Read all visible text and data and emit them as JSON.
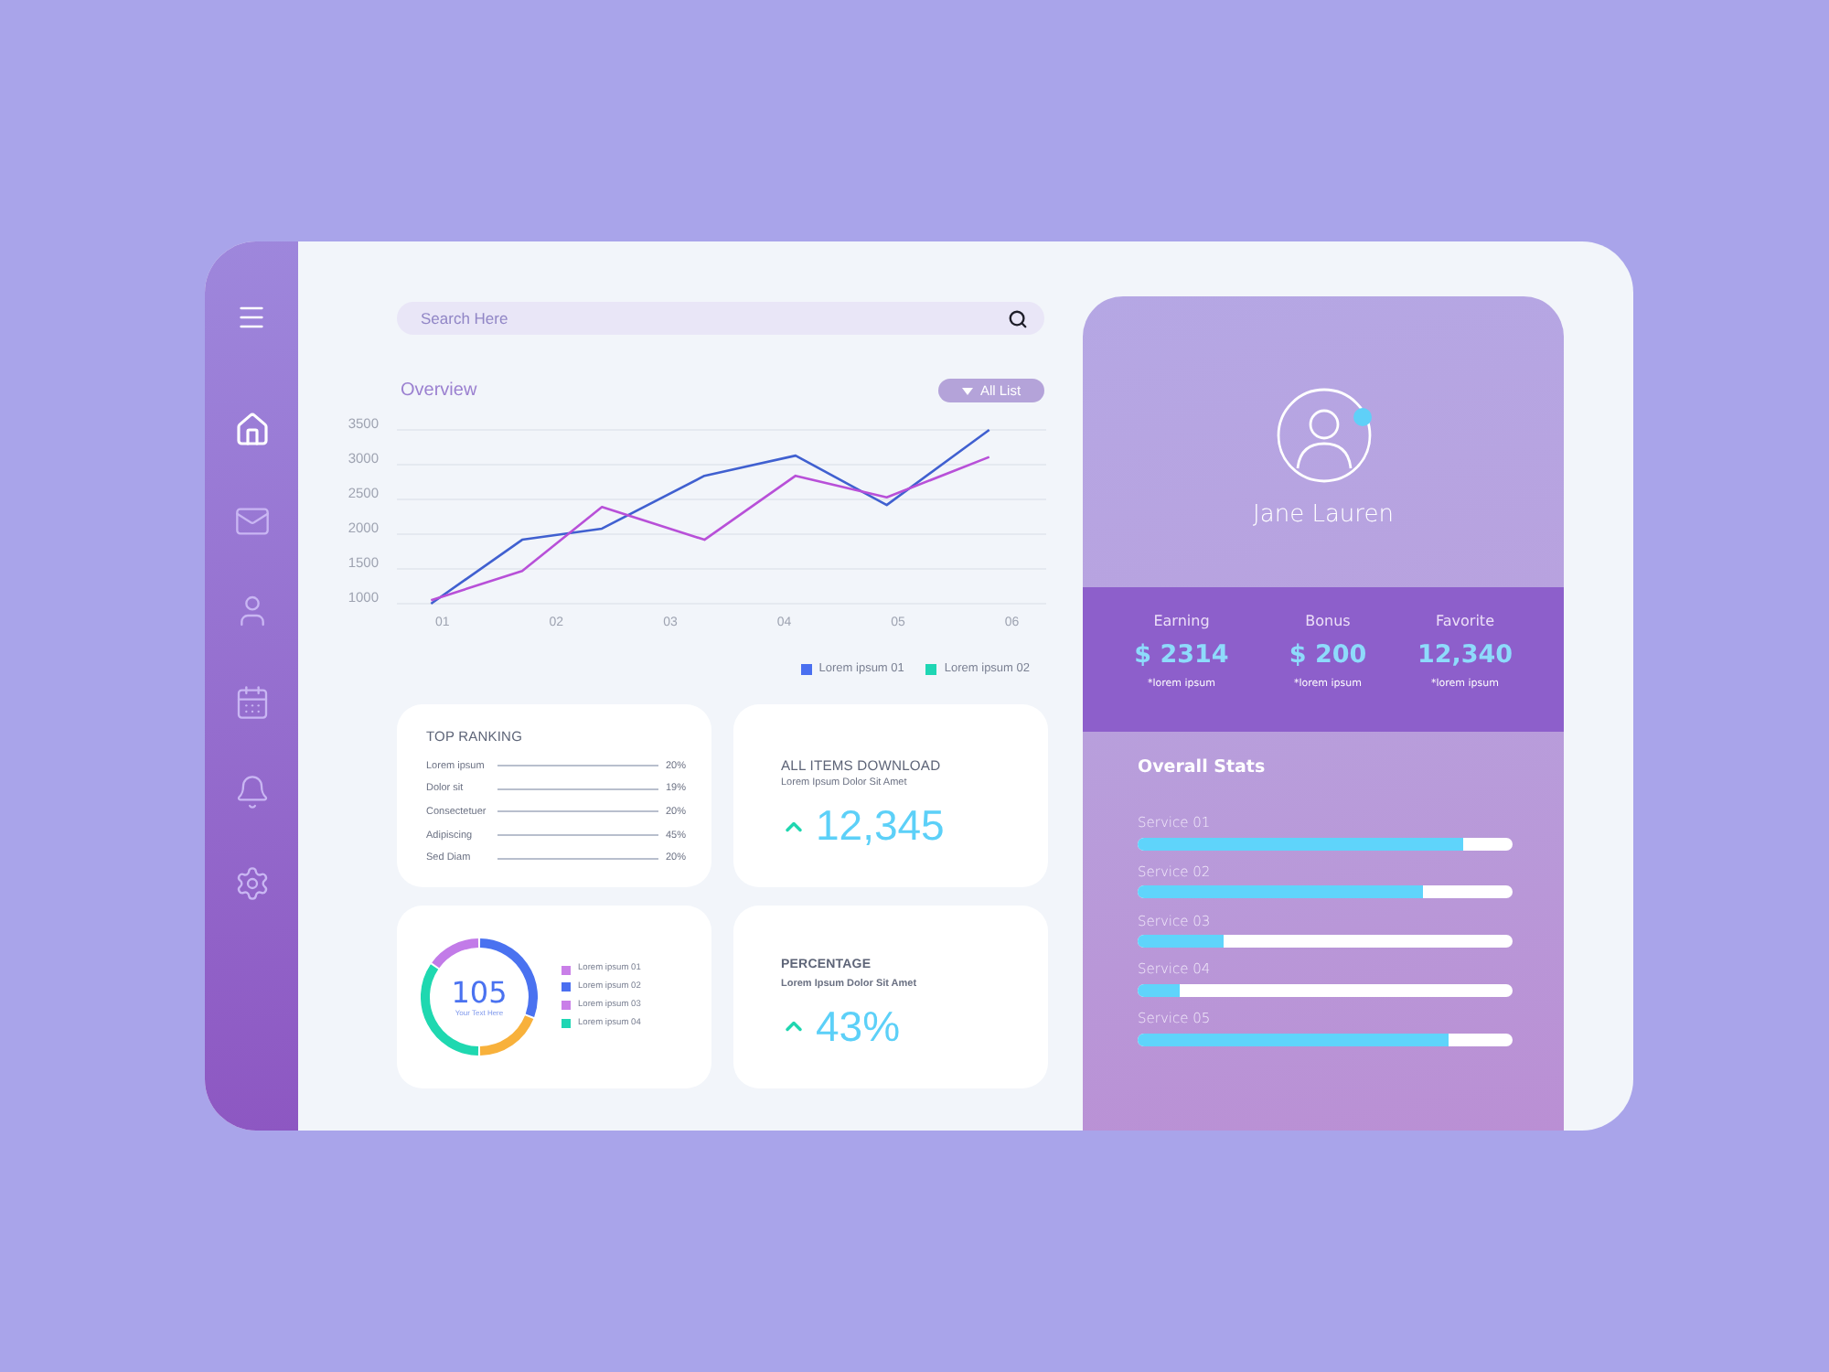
{
  "sidebar": {
    "items": [
      {
        "kind": "home",
        "selected": true
      },
      {
        "kind": "mail",
        "selected": false
      },
      {
        "kind": "user",
        "selected": false
      },
      {
        "kind": "calendar",
        "selected": false
      },
      {
        "kind": "bell",
        "selected": false
      },
      {
        "kind": "settings",
        "selected": false
      }
    ]
  },
  "search": {
    "placeholder": "Search Here"
  },
  "overview": {
    "title": "Overview",
    "filter": {
      "label": "All List"
    },
    "chart_data": {
      "type": "line",
      "grid": true,
      "x": [
        0.9,
        1.7,
        2.4,
        3.3,
        4.1,
        4.9,
        5.8
      ],
      "xlim": [
        0.6,
        6.3
      ],
      "ylim": [
        1000,
        3500
      ],
      "xticks": [
        {
          "value": 1,
          "label": "01"
        },
        {
          "value": 2,
          "label": "02"
        },
        {
          "value": 3,
          "label": "03"
        },
        {
          "value": 4,
          "label": "04"
        },
        {
          "value": 5,
          "label": "05"
        },
        {
          "value": 6,
          "label": "06"
        }
      ],
      "yticks": [
        1000,
        1500,
        2000,
        2500,
        3000,
        3500
      ],
      "series": [
        {
          "name": "Lorem ipsum 01",
          "color": "#4060d0",
          "values": [
            1000,
            1920,
            2080,
            2840,
            3130,
            2420,
            3500
          ]
        },
        {
          "name": "Lorem ipsum 02",
          "color": "#b850d8",
          "values": [
            1050,
            1470,
            2390,
            1920,
            2840,
            2530,
            3110
          ]
        }
      ]
    },
    "legend": [
      {
        "color": "#4a6ff0"
      },
      {
        "color": "#1fd6b4"
      }
    ]
  },
  "top_ranking": {
    "title": "TOP RANKING",
    "rows": [
      {
        "label": "Lorem ipsum",
        "value": "20%"
      },
      {
        "label": "Dolor sit",
        "value": "19%"
      },
      {
        "label": "Consectetuer",
        "value": "20%"
      },
      {
        "label": "Adipiscing",
        "value": "45%"
      },
      {
        "label": "Sed Diam",
        "value": "20%"
      }
    ]
  },
  "downloads": {
    "title": "ALL ITEMS DOWNLOAD",
    "subtitle": "Lorem Ipsum Dolor Sit Amet",
    "value": "12,345"
  },
  "donut_card": {
    "value": "105",
    "caption": "Your Text Here",
    "legend": [
      {
        "label": "Lorem ipsum 01",
        "color": "#c97fe8"
      },
      {
        "label": "Lorem ipsum 02",
        "color": "#4b6ff0"
      },
      {
        "label": "Lorem ipsum 03",
        "color": "#c97fe8"
      },
      {
        "label": "Lorem ipsum 04",
        "color": "#1fd6b4"
      }
    ]
  },
  "percentage": {
    "title": "PERCENTAGE",
    "subtitle": "Lorem Ipsum Dolor Sit Amet",
    "value": "43%"
  },
  "profile": {
    "name": "Jane Lauren",
    "online": true,
    "stats": [
      {
        "label": "Earning",
        "value": "$ 2314",
        "note": "*lorem ipsum"
      },
      {
        "label": "Bonus",
        "value": "$ 200",
        "note": "*lorem ipsum"
      },
      {
        "label": "Favorite",
        "value": "12,340",
        "note": "*lorem ipsum"
      }
    ]
  },
  "overall_stats": {
    "title": "Overall Stats",
    "services": [
      {
        "name": "Service 01",
        "level": 0.87
      },
      {
        "name": "Service 02",
        "level": 0.76
      },
      {
        "name": "Service 03",
        "level": 0.23
      },
      {
        "name": "Service 04",
        "level": 0.11
      },
      {
        "name": "Service 05",
        "level": 0.83
      }
    ]
  }
}
